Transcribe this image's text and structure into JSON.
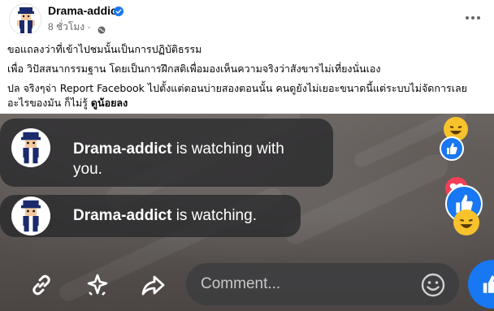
{
  "post": {
    "author": "Drama-addict",
    "time": "8 ชั่วโมง",
    "separator": "·",
    "caption_line1": "ขอแถลงว่าที่เข้าไปชมนั้นเป็นการปฏิบัติธรรม",
    "caption_line2": "เพื่อ วิปัสสนากรรมฐาน โดยเป็นการฝึกสติเพื่อมองเห็นความจริงว่าสังขารไม่เที่ยงนั่นเอง",
    "caption_line3a": "ปล จริงๆจ่า Report Facebook ไปตั้งแต่ตอนบ่ายสองตอนนั้น คนดูยังไม่เยอะขนาดนี้แต่ระบบไม่จัดการเลย",
    "caption_line3b": "อะไรของมัน ก็ไม่รู้ ",
    "caption_emphasis": "ดูน้อยลง"
  },
  "live": {
    "notifications": [
      {
        "name": "Drama-addict",
        "message": " is watching with you."
      },
      {
        "name": "Drama-addict",
        "message": " is watching."
      }
    ],
    "comment_placeholder": "Comment...",
    "accent_color": "#1877f2"
  },
  "icons": {
    "verified": "verified-badge-icon",
    "audience": "globe-icon",
    "more": "more-options-icon",
    "link": "link-icon",
    "stars": "sparkle-icon",
    "share": "share-icon",
    "emoji": "emoji-icon",
    "like": "like-icon"
  }
}
